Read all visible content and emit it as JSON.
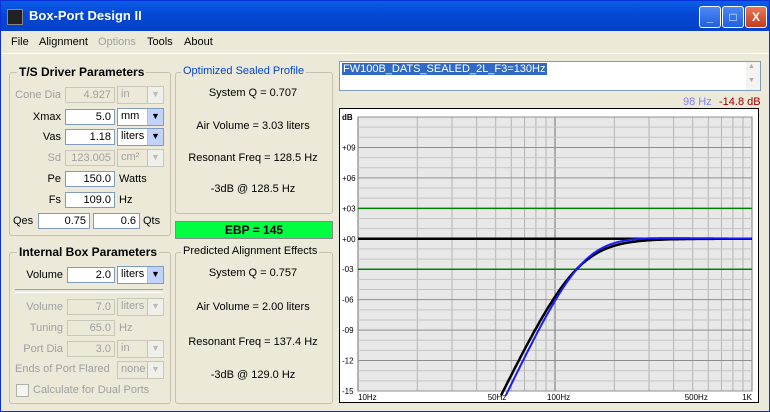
{
  "window": {
    "title": "Box-Port Design II",
    "minimize": "_",
    "maximize": "□",
    "close": "X"
  },
  "menu": {
    "file": "File",
    "alignment": "Alignment",
    "options": "Options",
    "tools": "Tools",
    "about": "About"
  },
  "ts": {
    "title": "T/S Driver Parameters",
    "cone_dia": {
      "label": "Cone Dia",
      "value": "4.927",
      "unit": "in"
    },
    "xmax": {
      "label": "Xmax",
      "value": "5.0",
      "unit": "mm"
    },
    "vas": {
      "label": "Vas",
      "value": "1.18",
      "unit": "liters"
    },
    "sd": {
      "label": "Sd",
      "value": "123.005",
      "unit": "cm²"
    },
    "pe": {
      "label": "Pe",
      "value": "150.0",
      "unit": "Watts"
    },
    "fs": {
      "label": "Fs",
      "value": "109.0",
      "unit": "Hz"
    },
    "qes": {
      "label": "Qes",
      "value": "0.75"
    },
    "qts": {
      "label": "Qts",
      "value": "0.6"
    }
  },
  "opt": {
    "title": "Optimized Sealed Profile",
    "system_q": "System Q = 0.707",
    "air_volume": "Air Volume = 3.03 liters",
    "res_freq": "Resonant Freq = 128.5 Hz",
    "minus3db": "-3dB @ 128.5 Hz"
  },
  "ebp": "EBP = 145",
  "box": {
    "title": "Internal Box Parameters",
    "volume": {
      "label": "Volume",
      "value": "2.0",
      "unit": "liters"
    },
    "volume2": {
      "label": "Volume",
      "value": "7.0",
      "unit": "liters"
    },
    "tuning": {
      "label": "Tuning",
      "value": "65.0",
      "unit": "Hz"
    },
    "port_dia": {
      "label": "Port Dia",
      "value": "3.0",
      "unit": "in"
    },
    "ends": {
      "label": "Ends of Port Flared",
      "value": "none"
    },
    "dual": "Calculate for Dual Ports"
  },
  "pred": {
    "title": "Predicted Alignment Effects",
    "system_q": "System Q = 0.757",
    "air_volume": "Air Volume = 2.00 liters",
    "res_freq": "Resonant Freq = 137.4 Hz",
    "minus3db": "-3dB @ 129.0 Hz"
  },
  "design_name": "FW100B_DATS_SEALED_2L_F3=130Hz",
  "readout": {
    "freq": "98 Hz",
    "db": "-14.8 dB",
    "freq_color": "#8080ff",
    "db_color": "#a00000"
  },
  "chart_data": {
    "type": "line",
    "ylabel": "dB",
    "x_scale": "log",
    "xlim": [
      10,
      1000
    ],
    "ylim": [
      -15,
      12
    ],
    "x_ticks": [
      {
        "v": 10,
        "label": "10Hz"
      },
      {
        "v": 50,
        "label": "50Hz"
      },
      {
        "v": 100,
        "label": "100Hz"
      },
      {
        "v": 500,
        "label": "500Hz"
      },
      {
        "v": 1000,
        "label": "1K"
      }
    ],
    "y_ticks": [
      {
        "v": 9,
        "label": "+09"
      },
      {
        "v": 6,
        "label": "+06"
      },
      {
        "v": 3,
        "label": "+03"
      },
      {
        "v": 0,
        "label": "+00"
      },
      {
        "v": -3,
        "label": "-03"
      },
      {
        "v": -6,
        "label": "-06"
      },
      {
        "v": -9,
        "label": "-09"
      },
      {
        "v": -12,
        "label": "-12"
      },
      {
        "v": -15,
        "label": "-15"
      }
    ],
    "reference_lines": [
      {
        "y": 3,
        "color": "#008000"
      },
      {
        "y": -3,
        "color": "#008000"
      },
      {
        "y": 0,
        "color": "#000000"
      }
    ],
    "grid": true,
    "series": [
      {
        "color": "#000000",
        "fc": 128.5,
        "q": 0.707
      },
      {
        "color": "#1a1aff",
        "fc": 137.4,
        "q": 0.757
      }
    ]
  }
}
